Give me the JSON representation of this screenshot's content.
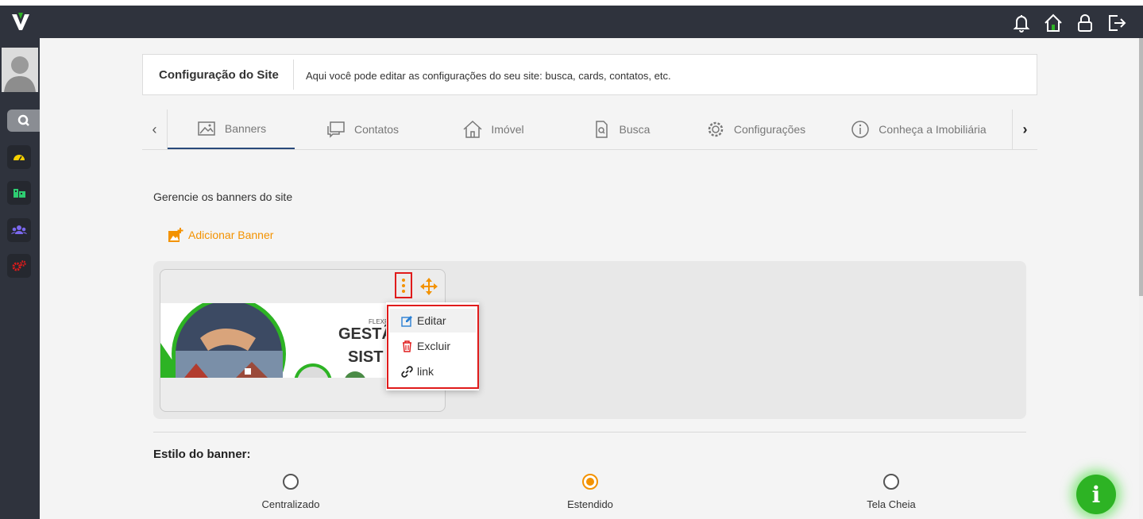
{
  "app": {
    "logo_letter": "V",
    "brand_color": "#f39200",
    "accent_green": "#2db324"
  },
  "topbar": {
    "icons": [
      "bell-icon",
      "home-icon",
      "lock-icon",
      "logout-icon"
    ]
  },
  "sidebar": {
    "items": [
      {
        "name": "search",
        "icon": "search-icon"
      },
      {
        "name": "dashboard",
        "icon": "gauge-icon",
        "color": "#f5d000"
      },
      {
        "name": "properties",
        "icon": "buildings-icon",
        "color": "#2ecc71"
      },
      {
        "name": "users",
        "icon": "users-icon",
        "color": "#7b68ee"
      },
      {
        "name": "settings",
        "icon": "gears-icon",
        "color": "#e01b1b"
      }
    ]
  },
  "header": {
    "title": "Configuração do Site",
    "description": "Aqui você pode editar as configurações do seu site: busca, cards, contatos, etc."
  },
  "tabs": [
    {
      "label": "Banners",
      "icon": "image-icon",
      "active": true
    },
    {
      "label": "Contatos",
      "icon": "chat-icon",
      "active": false
    },
    {
      "label": "Imóvel",
      "icon": "house-icon",
      "active": false
    },
    {
      "label": "Busca",
      "icon": "search-doc-icon",
      "active": false
    },
    {
      "label": "Configurações",
      "icon": "gear-icon",
      "active": false
    },
    {
      "label": "Conheça a Imobiliária",
      "icon": "info-icon",
      "active": false
    }
  ],
  "banners": {
    "section_label": "Gerencie os banners do site",
    "add_label": "Adicionar Banner",
    "image_text": {
      "small": "FLEXP",
      "line1": "GESTÃ",
      "line2": "SIST"
    },
    "menu": {
      "edit": "Editar",
      "delete": "Excluir",
      "link": "link"
    }
  },
  "banner_style": {
    "title": "Estilo do banner:",
    "options": [
      {
        "label": "Centralizado",
        "checked": false
      },
      {
        "label": "Estendido",
        "checked": true
      },
      {
        "label": "Tela Cheia",
        "checked": false
      }
    ]
  },
  "fab": {
    "symbol": "i"
  }
}
